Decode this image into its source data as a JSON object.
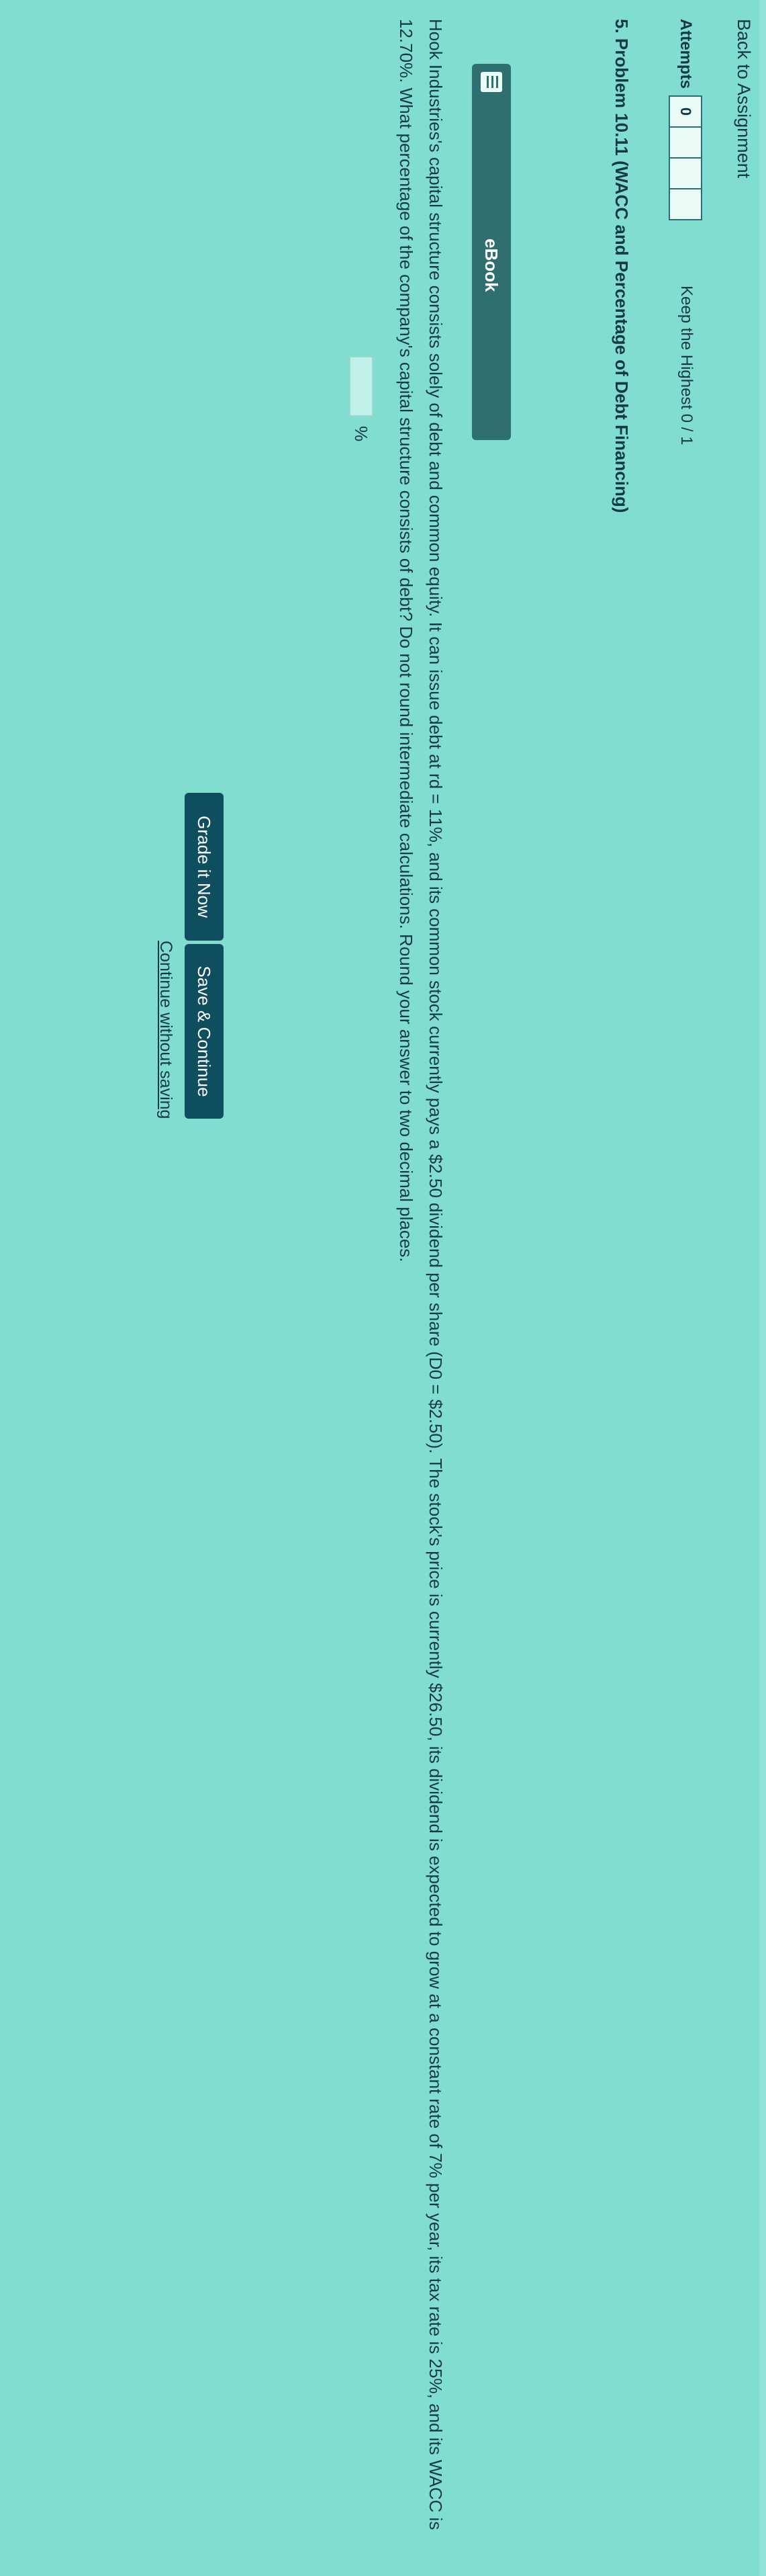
{
  "nav": {
    "back_label": "Back to Assignment"
  },
  "attempts": {
    "label": "Attempts",
    "boxes": [
      "0",
      "",
      "",
      ""
    ],
    "keep_highest": "Keep the Highest 0 / 1"
  },
  "problem": {
    "title": "5. Problem 10.11 (WACC and Percentage of Debt Financing)",
    "ebook_label": "eBook",
    "question": "Hook Industries's capital structure consists solely of debt and common equity. It can issue debt at rd = 11%, and its common stock currently pays a $2.50 dividend per share (D0 = $2.50). The stock's price is currently $26.50, its dividend is expected to grow at a constant rate of 7% per year, its tax rate is 25%, and its WACC is 12.70%. What percentage of the company's capital structure consists of debt? Do not round intermediate calculations. Round your answer to two decimal places.",
    "answer_value": "",
    "answer_unit": "%"
  },
  "actions": {
    "grade_label": "Grade it Now",
    "save_label": "Save & Continue",
    "continue_label": "Continue without saving"
  }
}
